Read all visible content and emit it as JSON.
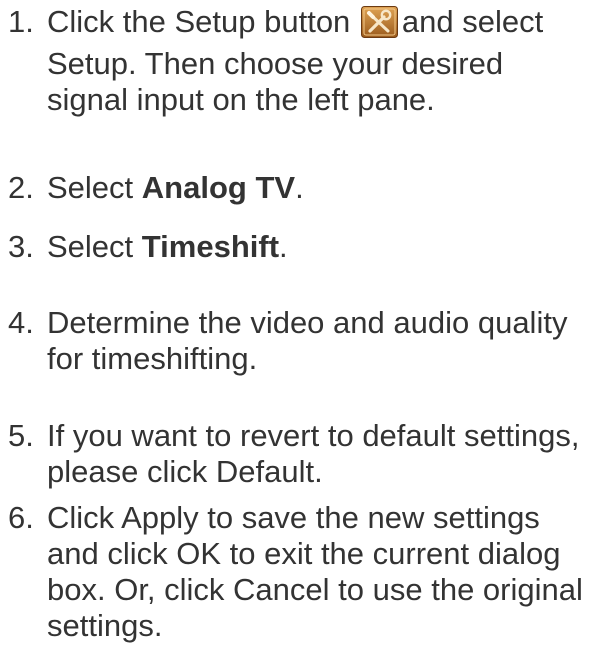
{
  "steps": [
    {
      "number": "1.",
      "before_icon": "Click the Setup button",
      "icon": "setup-tools-icon",
      "after_icon": "and select Setup. Then choose your desired signal input on the left pane."
    },
    {
      "number": "2.",
      "prefix": "Select",
      "bold": "Analog TV",
      "suffix": "."
    },
    {
      "number": "3.",
      "prefix": "Select",
      "bold": "Timeshift",
      "suffix": "."
    },
    {
      "number": "4.",
      "text": "Determine the video and audio quality for timeshifting."
    },
    {
      "number": "5.",
      "text": "If you want to revert to default settings, please click Default."
    },
    {
      "number": "6.",
      "text": "Click Apply to save the new settings and click OK to exit the current dialog box. Or, click Cancel to use the original settings."
    }
  ],
  "colors": {
    "text": "#333333",
    "icon_frame": "#6b3a12",
    "icon_fill": "#c9863a"
  }
}
